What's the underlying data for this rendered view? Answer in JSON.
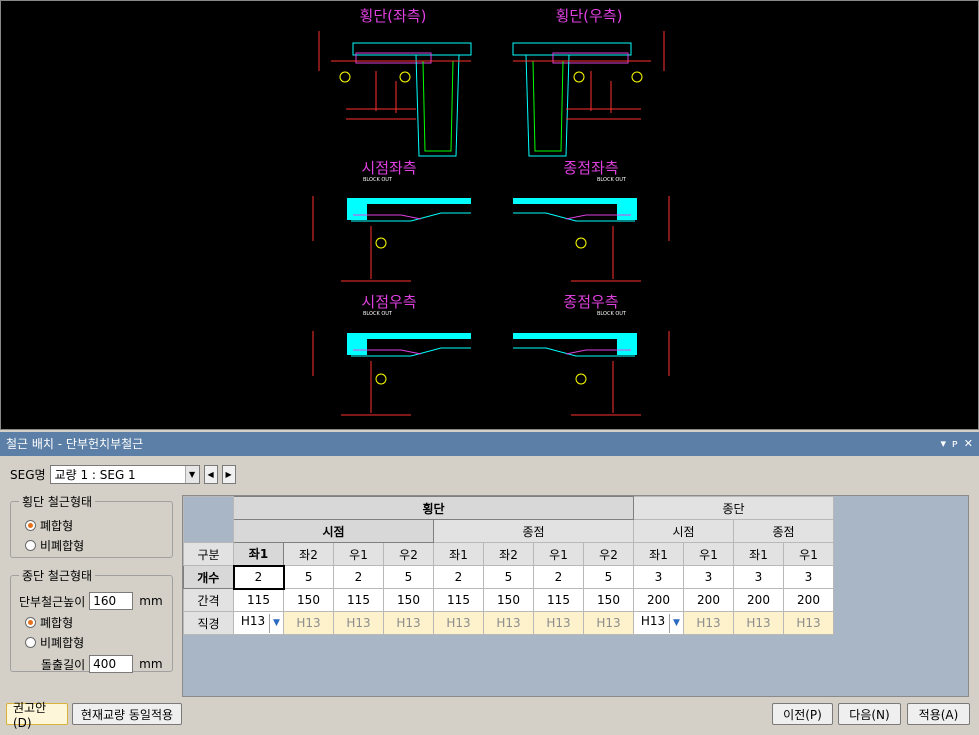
{
  "drawing": {
    "titles": [
      "횡단(좌측)",
      "횡단(우측)",
      "시점좌측",
      "종점좌측",
      "시점우측",
      "종점우측"
    ],
    "block_out": "BLOCK OUT"
  },
  "panel": {
    "title": "철근 배치 - 단부헌치부철근",
    "controls": [
      "▾",
      "ᴘ",
      "✕"
    ]
  },
  "seg": {
    "label": "SEG명",
    "value": "교량 1 : SEG 1"
  },
  "transverse_group": {
    "legend": "횡단 철근형태",
    "options": [
      "폐합형",
      "비폐합형"
    ],
    "selected": 0
  },
  "longitudinal_group": {
    "legend": "종단 철근형태",
    "height_label": "단부철근높이",
    "height_value": "160",
    "height_unit": "mm",
    "options": [
      "폐합형",
      "비폐합형"
    ],
    "selected": 0,
    "protrusion_label": "돌출길이",
    "protrusion_value": "400",
    "protrusion_unit": "mm"
  },
  "grid": {
    "group_headers": [
      "횡단",
      "종단"
    ],
    "sub_headers": [
      "시점",
      "종점",
      "시점",
      "종점"
    ],
    "corner": "구분",
    "columns": [
      "좌1",
      "좌2",
      "우1",
      "우2",
      "좌1",
      "좌2",
      "우1",
      "우2",
      "좌1",
      "우1",
      "좌1",
      "우1"
    ],
    "rows": [
      {
        "label": "개수",
        "values": [
          "2",
          "5",
          "2",
          "5",
          "2",
          "5",
          "2",
          "5",
          "3",
          "3",
          "3",
          "3"
        ]
      },
      {
        "label": "간격",
        "values": [
          "115",
          "150",
          "115",
          "150",
          "115",
          "150",
          "115",
          "150",
          "200",
          "200",
          "200",
          "200"
        ]
      },
      {
        "label": "직경",
        "values": [
          "H13",
          "H13",
          "H13",
          "H13",
          "H13",
          "H13",
          "H13",
          "H13",
          "H13",
          "H13",
          "H13",
          "H13"
        ]
      }
    ]
  },
  "buttons": {
    "recommend": "권고안(D)",
    "apply_same": "현재교량 동일적용",
    "prev": "이전(P)",
    "next": "다음(N)",
    "apply": "적용(A)"
  }
}
